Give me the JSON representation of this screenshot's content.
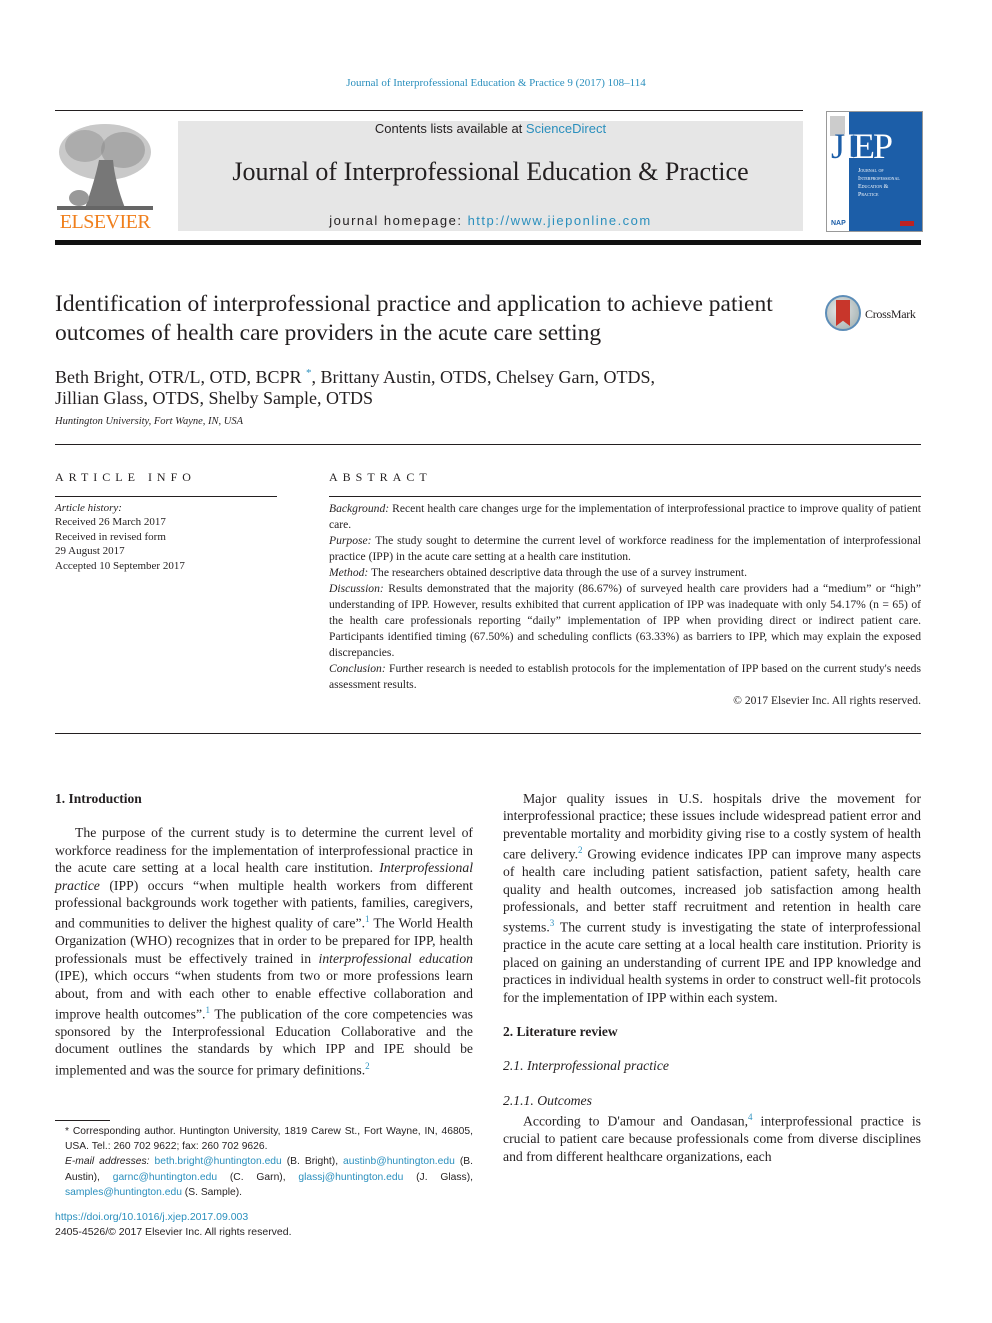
{
  "header": {
    "running_head": "Journal of Interprofessional Education & Practice 9 (2017) 108–114",
    "publisher_logo_text": "ELSEVIER",
    "contents_prefix": "Contents lists available at ",
    "contents_link": "ScienceDirect",
    "journal_title": "Journal of Interprofessional Education & Practice",
    "homepage_prefix": "journal homepage: ",
    "homepage_url": "http://www.jieponline.com",
    "cover": {
      "acronym_first": "J",
      "acronym_rest": "IEP",
      "subtitle_lines": [
        "Journal of",
        "Interprofessional",
        "Education &",
        "Practice"
      ],
      "publisher_badge": "NAP",
      "brand_color": "#1c5ea8"
    }
  },
  "article": {
    "title": "Identification of interprofessional practice and application to achieve patient outcomes of health care providers in the acute care setting",
    "crossmark_label": "CrossMark",
    "authors_line1_a": "Beth Bright, OTR/L, OTD, BCPR",
    "authors_line1_mark": "*",
    "authors_line1_b": ", Brittany Austin, OTDS, Chelsey Garn, OTDS,",
    "authors_line2": "Jillian Glass, OTDS, Shelby Sample, OTDS",
    "affiliation": "Huntington University, Fort Wayne, IN, USA"
  },
  "article_info": {
    "heading": "ARTICLE INFO",
    "history_label": "Article history:",
    "history": [
      "Received 26 March 2017",
      "Received in revised form",
      "29 August 2017",
      "Accepted 10 September 2017"
    ]
  },
  "abstract": {
    "heading": "ABSTRACT",
    "sections": [
      {
        "label": "Background:",
        "text": " Recent health care changes urge for the implementation of interprofessional practice to improve quality of patient care."
      },
      {
        "label": "Purpose:",
        "text": " The study sought to determine the current level of workforce readiness for the implementation of interprofessional practice (IPP) in the acute care setting at a health care institution."
      },
      {
        "label": "Method:",
        "text": " The researchers obtained descriptive data through the use of a survey instrument."
      },
      {
        "label": "Discussion:",
        "text": " Results demonstrated that the majority (86.67%) of surveyed health care providers had a “medium” or “high” understanding of IPP. However, results exhibited that current application of IPP was inadequate with only 54.17% (n = 65) of the health care professionals reporting “daily” implementation of IPP when providing direct or indirect patient care. Participants identified timing (67.50%) and scheduling conflicts (63.33%) as barriers to IPP, which may explain the exposed discrepancies."
      },
      {
        "label": "Conclusion:",
        "text": " Further research is needed to establish protocols for the implementation of IPP based on the current study's needs assessment results."
      }
    ],
    "copyright": "© 2017 Elsevier Inc. All rights reserved."
  },
  "body": {
    "intro_heading": "1.  Introduction",
    "intro_p1_a": "The purpose of the current study is to determine the current level of workforce readiness for the implementation of interprofessional practice in the acute care setting at a local health care institution. ",
    "intro_p1_term": "Interprofessional practice",
    "intro_p1_b": " (IPP) occurs “when multiple health workers from different professional backgrounds work together with patients, families, caregivers, and communities to deliver the highest quality of care”.",
    "ref1": "1",
    "intro_p1_c": " The World Health Organization (WHO) recognizes that in order to be prepared for IPP, health professionals must be effectively trained in ",
    "intro_p1_term2": "interprofessional education",
    "intro_p1_d": " (IPE), which occurs “when students from two or more professions learn about, from and with each other to enable effective collaboration and improve health outcomes”.",
    "ref1b": "1",
    "intro_p1_e": " The publication of the core competencies was sponsored by the Interprofessional Education Collaborative and the document outlines the standards by which IPP and IPE should be implemented and was the source for primary definitions.",
    "ref2": "2",
    "intro_p2_a": "Major quality issues in U.S. hospitals drive the movement for interprofessional practice; these issues include widespread patient error and preventable mortality and morbidity giving rise to a costly system of health care delivery.",
    "ref2b": "2",
    "intro_p2_b": " Growing evidence indicates IPP can improve many aspects of health care including patient satisfaction, patient safety, health care quality and health outcomes, increased job satisfaction among health professionals, and better staff recruitment and retention in health care systems.",
    "ref3": "3",
    "intro_p2_c": " The current study is investigating the state of interprofessional practice in the acute care setting at a local health care institution. Priority is placed on gaining an understanding of current IPE and IPP knowledge and practices in individual health systems in order to construct well-fit protocols for the implementation of IPP within each system.",
    "lit_heading": "2.  Literature review",
    "sub21": "2.1.  Interprofessional practice",
    "sub211": "2.1.1.  Outcomes",
    "outcomes_a": "According to D'amour and Oandasan,",
    "ref4": "4",
    "outcomes_b": " interprofessional practice is crucial to patient care because professionals come from diverse disciplines and from different healthcare organizations, each"
  },
  "footnotes": {
    "corresponding": "* Corresponding author. Huntington University, 1819 Carew St., Fort Wayne, IN, 46805, USA. Tel.: 260 702 9622; fax: 260 702 9626.",
    "email_label": "E-mail addresses:",
    "emails": [
      {
        "address": "beth.bright@huntington.edu",
        "who": " (B. Bright), "
      },
      {
        "address": "austinb@huntington.edu",
        "who": " (B. Austin), "
      },
      {
        "address": "garnc@huntington.edu",
        "who": " (C. Garn), "
      },
      {
        "address": "glassj@huntington.edu",
        "who": " (J. Glass), "
      },
      {
        "address": "samples@huntington.edu",
        "who": " (S. Sample)."
      }
    ],
    "doi": "https://doi.org/10.1016/j.xjep.2017.09.003",
    "issn_line": "2405-4526/© 2017 Elsevier Inc. All rights reserved."
  },
  "colors": {
    "link": "#2a8fbd",
    "elsevier_orange": "#f07f1c",
    "header_band": "#e6e6e6"
  }
}
